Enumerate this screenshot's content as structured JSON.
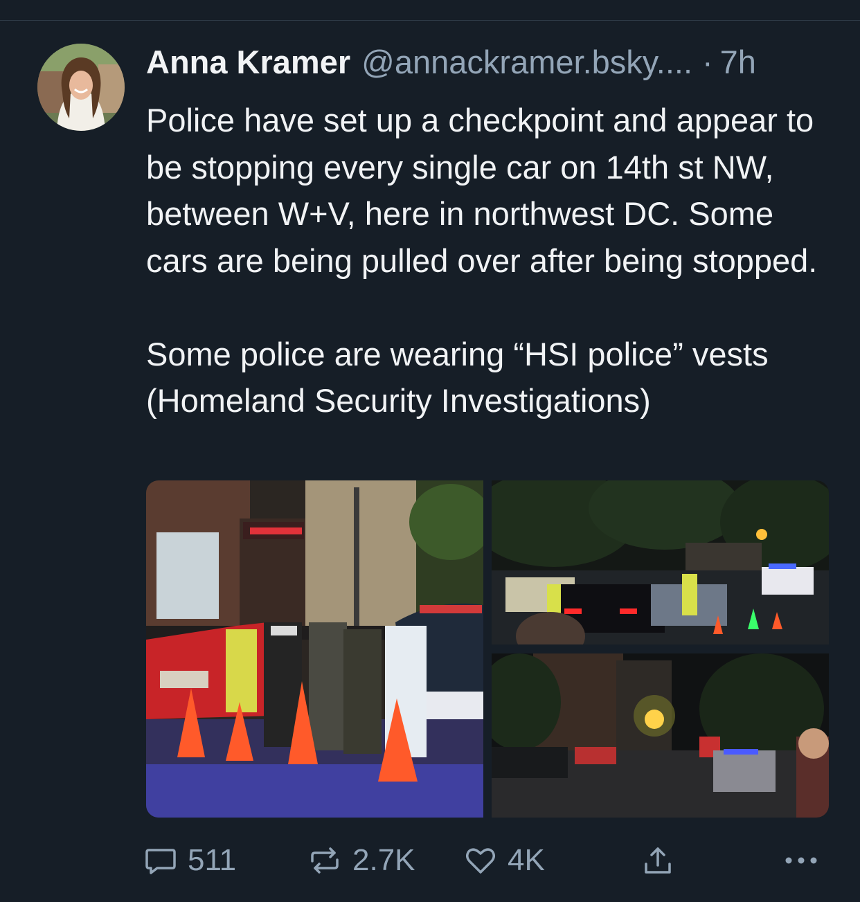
{
  "post": {
    "author_name": "Anna Kramer",
    "handle": "@annackramer.bsky....",
    "separator": "·",
    "time": "7h",
    "text_paragraph_1": "Police have set up a checkpoint and appear to be stopping every single car on 14th st NW, between W+V, here in northwest DC. Some cars are being pulled over after being stopped.",
    "text_paragraph_2": "Some police are wearing “HSI police” vests (Homeland Security Investigations)"
  },
  "actions": {
    "reply_count": "511",
    "repost_count": "2.7K",
    "like_count": "4K"
  },
  "icons": {
    "reply": "speech-bubble-icon",
    "repost": "repost-arrows-icon",
    "like": "heart-icon",
    "share": "share-upload-icon",
    "more": "ellipsis-icon"
  },
  "colors": {
    "background": "#161e27",
    "text": "#f1f3f5",
    "secondary_text": "#93a5b7"
  }
}
